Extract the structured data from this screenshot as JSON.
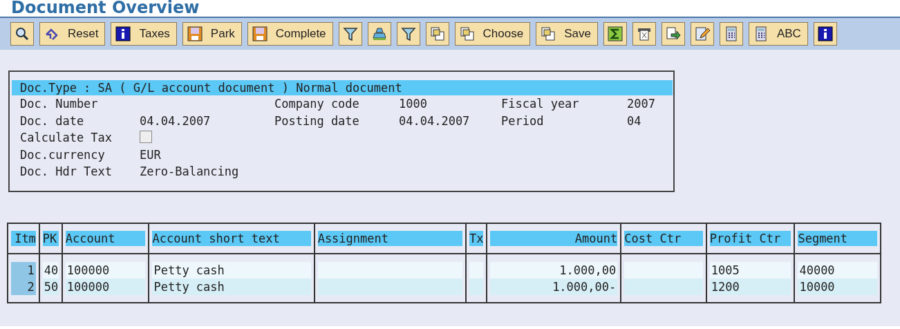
{
  "title": "Document Overview",
  "toolbar": [
    {
      "kind": "icon"
    },
    {
      "kind": "labeled",
      "label": "Reset"
    },
    {
      "kind": "labeled",
      "label": "Taxes"
    },
    {
      "kind": "labeled",
      "label": "Park"
    },
    {
      "kind": "labeled",
      "label": "Complete"
    },
    {
      "kind": "icon"
    },
    {
      "kind": "icon"
    },
    {
      "kind": "icon"
    },
    {
      "kind": "icon"
    },
    {
      "kind": "labeled",
      "label": "Choose"
    },
    {
      "kind": "labeled",
      "label": "Save"
    },
    {
      "kind": "icon"
    },
    {
      "kind": "icon"
    },
    {
      "kind": "icon"
    },
    {
      "kind": "icon"
    },
    {
      "kind": "icon"
    },
    {
      "kind": "labeled",
      "label": "ABC"
    },
    {
      "kind": "icon"
    }
  ],
  "header": {
    "doc_type": "Doc.Type : SA ( G/L account document ) Normal document",
    "rows": [
      [
        {
          "kind": "text",
          "label": "Doc. Number"
        },
        {
          "kind": "text",
          "label": "Company code",
          "value": "1000"
        },
        {
          "kind": "text",
          "label": "Fiscal year",
          "value": "2007"
        }
      ],
      [
        {
          "kind": "text",
          "label": "Doc. date",
          "value": "04.04.2007"
        },
        {
          "kind": "text",
          "label": "Posting date",
          "value": "04.04.2007"
        },
        {
          "kind": "text",
          "label": "Period",
          "value": "04"
        }
      ],
      [
        {
          "kind": "checkbox",
          "label": "Calculate Tax",
          "checked": false
        }
      ],
      [
        {
          "kind": "text",
          "label": "Doc.currency",
          "value": "EUR"
        }
      ],
      [
        {
          "kind": "text",
          "label": "Doc. Hdr Text",
          "value": "Zero-Balancing"
        }
      ]
    ]
  },
  "table": {
    "columns": [
      "Itm",
      "PK",
      "Account",
      "Account short text",
      "Assignment",
      "Tx",
      "Amount",
      "Cost Ctr",
      "Profit Ctr",
      "Segment"
    ],
    "rows": [
      {
        "cells": [
          {
            "kind": "text",
            "text": "1"
          },
          {
            "kind": "text",
            "text": "40"
          },
          {
            "kind": "text",
            "text": "100000"
          },
          {
            "kind": "text",
            "text": "Petty cash"
          },
          {
            "kind": "empty"
          },
          {
            "kind": "empty"
          },
          {
            "kind": "text",
            "text": "1.000,00"
          },
          {
            "kind": "empty"
          },
          {
            "kind": "text",
            "text": "1005"
          },
          {
            "kind": "text",
            "text": "40000"
          }
        ]
      },
      {
        "cells": [
          {
            "kind": "text",
            "text": "2"
          },
          {
            "kind": "text",
            "text": "50"
          },
          {
            "kind": "text",
            "text": "100000"
          },
          {
            "kind": "text",
            "text": "Petty cash"
          },
          {
            "kind": "empty"
          },
          {
            "kind": "empty"
          },
          {
            "kind": "text",
            "text": "1.000,00-"
          },
          {
            "kind": "empty"
          },
          {
            "kind": "text",
            "text": "1200"
          },
          {
            "kind": "text",
            "text": "10000"
          }
        ]
      }
    ]
  }
}
